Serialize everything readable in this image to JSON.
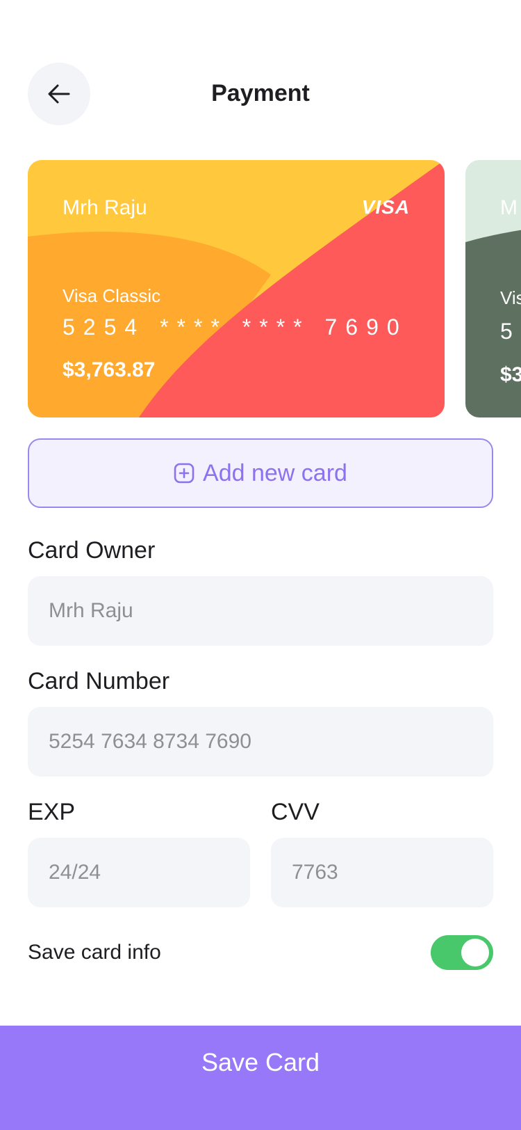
{
  "header": {
    "title": "Payment",
    "back_icon": "arrow-left-icon"
  },
  "cards": [
    {
      "owner": "Mrh Raju",
      "brand": "VISA",
      "type": "Visa Classic",
      "number": "5254 **** **** 7690",
      "balance": "$3,763.87",
      "colors": {
        "base": "#FFC83D",
        "mid": "#FFA92E",
        "accent": "#FF5A5A"
      }
    },
    {
      "owner": "M",
      "type": "Vis",
      "number": "5",
      "balance": "$3",
      "colors": {
        "base": "#DCEBDF",
        "accent": "#5E7060"
      }
    }
  ],
  "add_card": {
    "label": "Add new card",
    "icon": "plus-square-icon"
  },
  "form": {
    "owner_label": "Card Owner",
    "owner_value": "Mrh Raju",
    "number_label": "Card Number",
    "number_value": "5254 7634 8734 7690",
    "exp_label": "EXP",
    "exp_value": "24/24",
    "cvv_label": "CVV",
    "cvv_value": "7763"
  },
  "save_info": {
    "label": "Save card info",
    "enabled": true
  },
  "submit": {
    "label": "Save Card"
  },
  "colors": {
    "primary": "#9778F8",
    "toggle_on": "#48C76B",
    "field_bg": "#F4F5F9"
  }
}
